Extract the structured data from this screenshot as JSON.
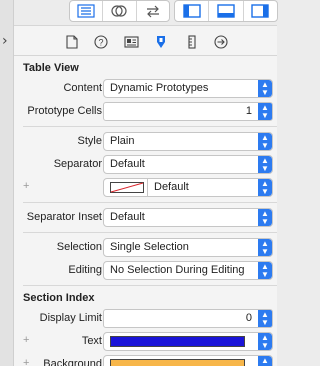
{
  "toolbar": {
    "left_group": [
      "navigator-icon",
      "assistant-editor-icon",
      "version-editor-icon"
    ],
    "right_group": [
      "left-panel-icon",
      "bottom-panel-icon",
      "right-panel-icon"
    ],
    "accent": "#1a6fe8"
  },
  "inspector_tabs": [
    "file-icon",
    "quick-help-icon",
    "identity-icon",
    "attributes-icon",
    "size-icon",
    "connections-icon"
  ],
  "table_view": {
    "title": "Table View",
    "content_label": "Content",
    "content_value": "Dynamic Prototypes",
    "prototype_cells_label": "Prototype Cells",
    "prototype_cells_value": "1",
    "style_label": "Style",
    "style_value": "Plain",
    "separator_label": "Separator",
    "separator_value": "Default",
    "separator_color_value": "Default",
    "separator_inset_label": "Separator Inset",
    "separator_inset_value": "Default",
    "selection_label": "Selection",
    "selection_value": "Single Selection",
    "editing_label": "Editing",
    "editing_value": "No Selection During Editing"
  },
  "section_index": {
    "title": "Section Index",
    "display_limit_label": "Display Limit",
    "display_limit_value": "0",
    "text_label": "Text",
    "text_color": "#1a14d8",
    "background_label": "Background",
    "background_color": "#f7b64a"
  }
}
